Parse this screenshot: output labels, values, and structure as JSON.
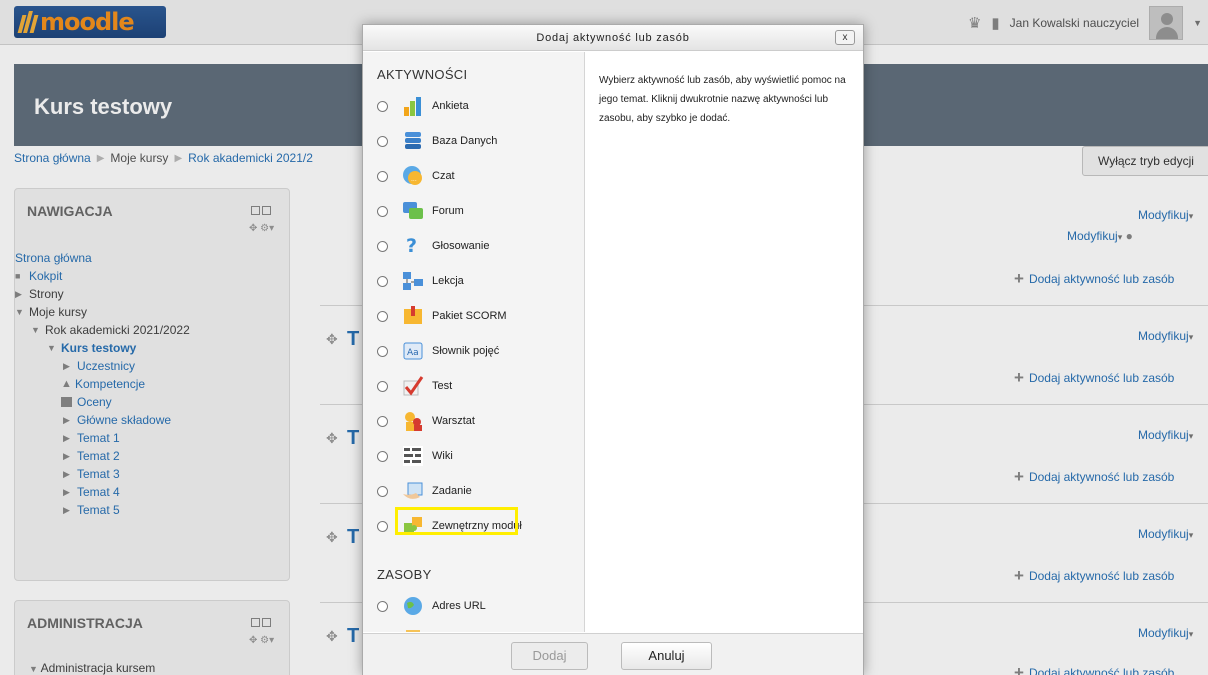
{
  "topbar": {
    "logo_text": "moodle",
    "username": "Jan Kowalski nauczyciel",
    "icons": [
      "notification-icon",
      "message-icon"
    ]
  },
  "course": {
    "title": "Kurs testowy"
  },
  "breadcrumb": [
    "Strona główna",
    "Moje kursy",
    "Rok akademicki 2021/2"
  ],
  "edit_mode_button": "Wyłącz tryb edycji",
  "navigation": {
    "title": "NAWIGACJA",
    "items": [
      {
        "label": "Strona główna"
      },
      {
        "label": "Kokpit"
      },
      {
        "label": "Strony"
      },
      {
        "label": "Moje kursy"
      },
      {
        "label": "Rok akademicki 2021/2022"
      },
      {
        "label": "Kurs testowy"
      },
      {
        "label": "Uczestnicy"
      },
      {
        "label": "Kompetencje"
      },
      {
        "label": "Oceny"
      },
      {
        "label": "Główne składowe"
      },
      {
        "label": "Temat 1"
      },
      {
        "label": "Temat 2"
      },
      {
        "label": "Temat 3"
      },
      {
        "label": "Temat 4"
      },
      {
        "label": "Temat 5"
      }
    ]
  },
  "administration": {
    "title": "ADMINISTRACJA",
    "first_item": "Administracja kursem"
  },
  "content": {
    "modify_label": "Modyfikuj",
    "add_label": "Dodaj aktywność lub zasób",
    "section_title_letter": "T"
  },
  "modal": {
    "title": "Dodaj aktywność lub zasób",
    "close_label": "x",
    "activities_label": "AKTYWNOŚCI",
    "activities": [
      {
        "label": "Ankieta",
        "icon": "survey-icon"
      },
      {
        "label": "Baza Danych",
        "icon": "database-icon"
      },
      {
        "label": "Czat",
        "icon": "chat-icon"
      },
      {
        "label": "Forum",
        "icon": "forum-icon"
      },
      {
        "label": "Głosowanie",
        "icon": "choice-icon"
      },
      {
        "label": "Lekcja",
        "icon": "lesson-icon"
      },
      {
        "label": "Pakiet SCORM",
        "icon": "scorm-icon"
      },
      {
        "label": "Słownik pojęć",
        "icon": "glossary-icon"
      },
      {
        "label": "Test",
        "icon": "quiz-icon"
      },
      {
        "label": "Warsztat",
        "icon": "workshop-icon"
      },
      {
        "label": "Wiki",
        "icon": "wiki-icon"
      },
      {
        "label": "Zadanie",
        "icon": "assignment-icon"
      },
      {
        "label": "Zewnętrzny moduł",
        "icon": "external-tool-icon"
      }
    ],
    "resources_label": "ZASOBY",
    "resources": [
      {
        "label": "Adres URL",
        "icon": "url-icon"
      }
    ],
    "help_text": "Wybierz aktywność lub zasób, aby wyświetlić pomoc na jego temat. Kliknij dwukrotnie nazwę aktywności lub zasobu, aby szybko je dodać.",
    "add_button": "Dodaj",
    "cancel_button": "Anuluj"
  }
}
